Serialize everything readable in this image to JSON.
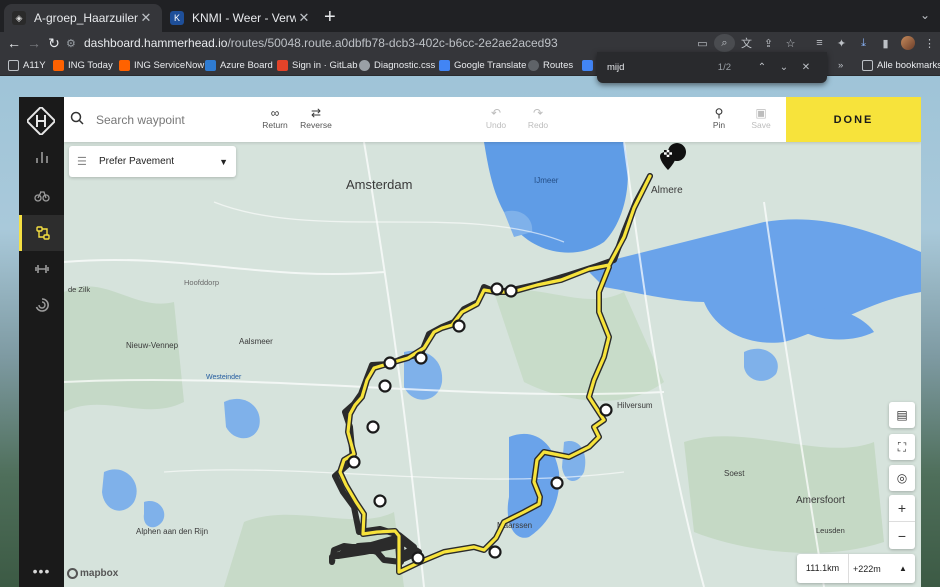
{
  "tabs": [
    {
      "title": "A-groep_Haarzuilen",
      "active": true,
      "favicon": "hammerhead-icon"
    },
    {
      "title": "KNMI - Weer - Verwachtingen",
      "active": false,
      "favicon": "knmi-icon"
    }
  ],
  "address": {
    "host": "dashboard.hammerhead.io",
    "path": "/routes/50048.route.a0dbfb78-dcb3-402c-b6cc-2e2ae2aced93"
  },
  "bookmarks": [
    {
      "label": "A11Y",
      "color": "#8ab4f8"
    },
    {
      "label": "ING Today",
      "color": "#ff6200"
    },
    {
      "label": "ING ServiceNow",
      "color": "#ff6200"
    },
    {
      "label": "Azure Board",
      "color": "#2f7cd3"
    },
    {
      "label": "Sign in · GitLab",
      "color": "#e24329"
    },
    {
      "label": "Diagnostic.css",
      "color": "#9aa0a6"
    },
    {
      "label": "Google Translate",
      "color": "#4285f4"
    },
    {
      "label": "Routes",
      "color": "#5f6368"
    }
  ],
  "all_bookmarks": "Alle bookmarks",
  "find": {
    "query": "mijd",
    "count": "1/2"
  },
  "app": {
    "search_placeholder": "Search waypoint",
    "tools": {
      "return": "Return",
      "reverse": "Reverse",
      "undo": "Undo",
      "redo": "Redo",
      "pin": "Pin",
      "save": "Save"
    },
    "done": "DONE",
    "prefer": "Prefer Pavement",
    "distance": "111.1km",
    "elevation": "+222m",
    "attribution": "mapbox",
    "accent": "#f7e33b"
  },
  "map_labels": [
    {
      "text": "Amsterdam"
    },
    {
      "text": "IJmeer"
    },
    {
      "text": "Almere"
    },
    {
      "text": "Aalsmeer"
    },
    {
      "text": "Nieuw-Vennep"
    },
    {
      "text": "Hoofddorp"
    },
    {
      "text": "de Zilk"
    },
    {
      "text": "Westeinder"
    },
    {
      "text": "Hilversum"
    },
    {
      "text": "Soest"
    },
    {
      "text": "Amersfoort"
    },
    {
      "text": "Leusden"
    },
    {
      "text": "Maarssen"
    },
    {
      "text": "Alphen aan den Rijn"
    }
  ]
}
